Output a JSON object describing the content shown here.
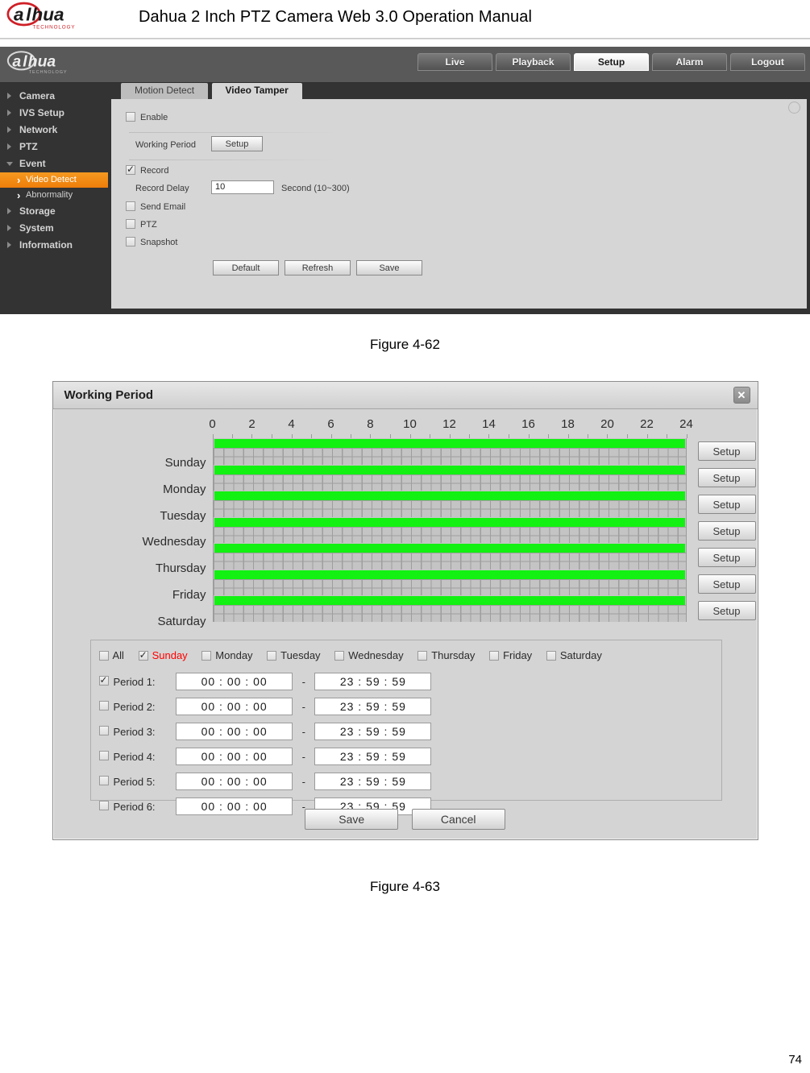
{
  "document": {
    "header_title": "Dahua 2 Inch PTZ Camera Web 3.0 Operation Manual",
    "logo_text": "alhua",
    "logo_sub": "TECHNOLOGY",
    "page_number": "74",
    "figure_1_caption": "Figure 4-62",
    "figure_2_caption": "Figure 4-63"
  },
  "webui": {
    "brand_text": "alhua",
    "brand_sub": "TECHNOLOGY",
    "nav_tabs": [
      {
        "label": "Live",
        "active": false
      },
      {
        "label": "Playback",
        "active": false
      },
      {
        "label": "Setup",
        "active": true
      },
      {
        "label": "Alarm",
        "active": false
      },
      {
        "label": "Logout",
        "active": false
      }
    ],
    "help_icon": "?",
    "sidebar": [
      {
        "label": "Camera",
        "type": "group",
        "expanded": false
      },
      {
        "label": "IVS Setup",
        "type": "group",
        "expanded": false
      },
      {
        "label": "Network",
        "type": "group",
        "expanded": false
      },
      {
        "label": "PTZ",
        "type": "group",
        "expanded": false
      },
      {
        "label": "Event",
        "type": "group",
        "expanded": true
      },
      {
        "label": "Video Detect",
        "type": "sub",
        "selected": true
      },
      {
        "label": "Abnormality",
        "type": "sub",
        "selected": false
      },
      {
        "label": "Storage",
        "type": "group",
        "expanded": false
      },
      {
        "label": "System",
        "type": "group",
        "expanded": false
      },
      {
        "label": "Information",
        "type": "group",
        "expanded": false
      }
    ],
    "content_tabs": [
      {
        "label": "Motion Detect",
        "active": false
      },
      {
        "label": "Video Tamper",
        "active": true
      }
    ],
    "form": {
      "enable_label": "Enable",
      "enable_checked": false,
      "working_period_label": "Working Period",
      "working_period_button": "Setup",
      "record_label": "Record",
      "record_checked": true,
      "record_delay_label": "Record Delay",
      "record_delay_value": "10",
      "record_delay_unit": "Second (10~300)",
      "send_email_label": "Send Email",
      "send_email_checked": false,
      "ptz_label": "PTZ",
      "ptz_checked": false,
      "snapshot_label": "Snapshot",
      "snapshot_checked": false,
      "buttons": [
        "Default",
        "Refresh",
        "Save"
      ]
    }
  },
  "dialog": {
    "title": "Working Period",
    "close_glyph": "✕",
    "hour_ticks": [
      "0",
      "2",
      "4",
      "6",
      "8",
      "10",
      "12",
      "14",
      "16",
      "18",
      "20",
      "22",
      "24"
    ],
    "days": [
      {
        "name": "Sunday",
        "setup_label": "Setup",
        "bar_start_hour": 0,
        "bar_end_hour": 24
      },
      {
        "name": "Monday",
        "setup_label": "Setup",
        "bar_start_hour": 0,
        "bar_end_hour": 24
      },
      {
        "name": "Tuesday",
        "setup_label": "Setup",
        "bar_start_hour": 0,
        "bar_end_hour": 24
      },
      {
        "name": "Wednesday",
        "setup_label": "Setup",
        "bar_start_hour": 0,
        "bar_end_hour": 24
      },
      {
        "name": "Thursday",
        "setup_label": "Setup",
        "bar_start_hour": 0,
        "bar_end_hour": 24
      },
      {
        "name": "Friday",
        "setup_label": "Setup",
        "bar_start_hour": 0,
        "bar_end_hour": 24
      },
      {
        "name": "Saturday",
        "setup_label": "Setup",
        "bar_start_hour": 0,
        "bar_end_hour": 24
      }
    ],
    "day_checkboxes": [
      {
        "label": "All",
        "checked": false,
        "highlight": false
      },
      {
        "label": "Sunday",
        "checked": true,
        "highlight": true
      },
      {
        "label": "Monday",
        "checked": false,
        "highlight": false
      },
      {
        "label": "Tuesday",
        "checked": false,
        "highlight": false
      },
      {
        "label": "Wednesday",
        "checked": false,
        "highlight": false
      },
      {
        "label": "Thursday",
        "checked": false,
        "highlight": false
      },
      {
        "label": "Friday",
        "checked": false,
        "highlight": false
      },
      {
        "label": "Saturday",
        "checked": false,
        "highlight": false
      }
    ],
    "periods": [
      {
        "label": "Period 1:",
        "checked": true,
        "start": "00 : 00 : 00",
        "end": "23 : 59 : 59"
      },
      {
        "label": "Period 2:",
        "checked": false,
        "start": "00 : 00 : 00",
        "end": "23 : 59 : 59"
      },
      {
        "label": "Period 3:",
        "checked": false,
        "start": "00 : 00 : 00",
        "end": "23 : 59 : 59"
      },
      {
        "label": "Period 4:",
        "checked": false,
        "start": "00 : 00 : 00",
        "end": "23 : 59 : 59"
      },
      {
        "label": "Period 5:",
        "checked": false,
        "start": "00 : 00 : 00",
        "end": "23 : 59 : 59"
      },
      {
        "label": "Period 6:",
        "checked": false,
        "start": "00 : 00 : 00",
        "end": "23 : 59 : 59"
      }
    ],
    "range_separator": "-",
    "save_label": "Save",
    "cancel_label": "Cancel"
  },
  "colors": {
    "accent_orange": "#ee7d0a",
    "schedule_green": "#12f112",
    "selected_day_red": "#ff0000",
    "ui_dark": "#333333",
    "panel_gray": "#d6d6d6"
  }
}
